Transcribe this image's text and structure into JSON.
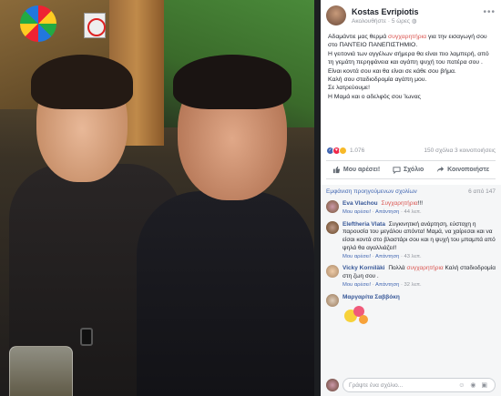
{
  "post": {
    "author": "Kostas Evripiotis",
    "follow_label": "Ακολουθήστε",
    "time": "5 ώρες",
    "text_before_hl": "Αδαμάντιε μας θερμά ",
    "hl1": "συγχαρητήρια",
    "text_after_hl": " για την εισαγωγή σου στο ΠΑΝΤΕΙΟ ΠΑΝΕΠΙΣΤΗΜΙΟ.",
    "line2": "Η γειτονιά των αγγέλων σήμερα θα είναι πιο λαμπερή, από τη γεμάτη περηφάνεια και αγάπη ψυχή του πατέρα σου .",
    "line3": "Είναι κοντά σου και θα είναι σε κάθε σου βήμα.",
    "line4": "Καλή σου σταδιοδρομία αγάπη μου.",
    "line5": "Σε λατρεύουμε!",
    "line6": "Η Μαμά και ο αδελφός σου Ίωνας",
    "reaction_count": "1.076",
    "comments_shares": "150 σχόλια  3 κοινοποιήσεις",
    "like_label": "Μου αρέσει!",
    "comment_label": "Σχόλιο",
    "share_label": "Κοινοποιήστε"
  },
  "comments": {
    "view_previous": "Εμφάνιση προηγούμενων σχολίων",
    "count": "6 από 147",
    "items": [
      {
        "name": "Eva Vlachou",
        "text_hl": "Συγχαρητήρια",
        "text": "!!!",
        "like": "Μου αρέσει!",
        "reply": "Απάντηση",
        "time": "44 λεπ."
      },
      {
        "name": "Eleftheria Vlata",
        "text": "Συγκινητική ανάρτηση, εύστοχη η παρουσία του μεγάλου απόντα! Μαμά, να χαίρεσαι και να είσαι κοντά στο βλαστάρι σου και η ψυχή του μπαμπά από ψηλά θα αγαλλιάζει!!",
        "like": "Μου αρέσει!",
        "reply": "Απάντηση",
        "time": "43 λεπ."
      },
      {
        "name": "Vicky Korniläki",
        "text_pre": "Πολλά ",
        "text_hl": "συγχαρητήρια",
        "text": " Καλή σταδιοδρομία στη ζωη σου .",
        "like": "Μου αρέσει!",
        "reply": "Απάντηση",
        "time": "32 λεπ."
      },
      {
        "name": "Μαργαρίτα Σαββόκη",
        "text": "",
        "like": "",
        "reply": "",
        "time": ""
      }
    ],
    "write_placeholder": "Γράψτε ένα σχόλιο..."
  },
  "colors": {
    "accent": "#4267b2",
    "highlight": "#d9534f"
  }
}
